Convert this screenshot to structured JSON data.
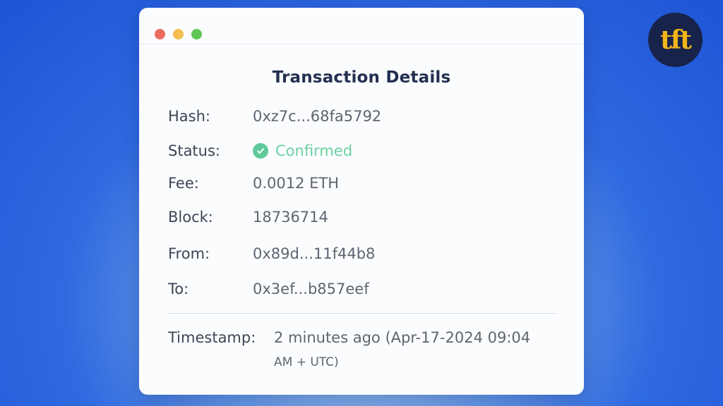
{
  "window": {
    "title": "Transaction Details",
    "controls": [
      "close",
      "minimize",
      "maximize"
    ]
  },
  "details": {
    "hash": {
      "label": "Hash:",
      "value": "0xz7c...68fa5792"
    },
    "status": {
      "label": "Status:",
      "value": "Confirmed",
      "icon": "check-circle-icon",
      "color": "#6cd1a1"
    },
    "fee": {
      "label": "Fee:",
      "value": "0.0012 ETH"
    },
    "block": {
      "label": "Block:",
      "value": "18736714"
    },
    "from": {
      "label": "From:",
      "value": "0x89d...11f44b8"
    },
    "to": {
      "label": "To:",
      "value": "0x3ef...b857eef"
    }
  },
  "timestamp": {
    "label": "Timestamp:",
    "line1": "2 minutes ago (Apr-17-2024 09:04",
    "line2": "AM + UTC)"
  },
  "logo": {
    "text": "tft"
  },
  "colors": {
    "background": "#2f6ae0",
    "panel": "#fbfcfe",
    "title": "#22304f",
    "confirmed": "#6cd1a1"
  }
}
